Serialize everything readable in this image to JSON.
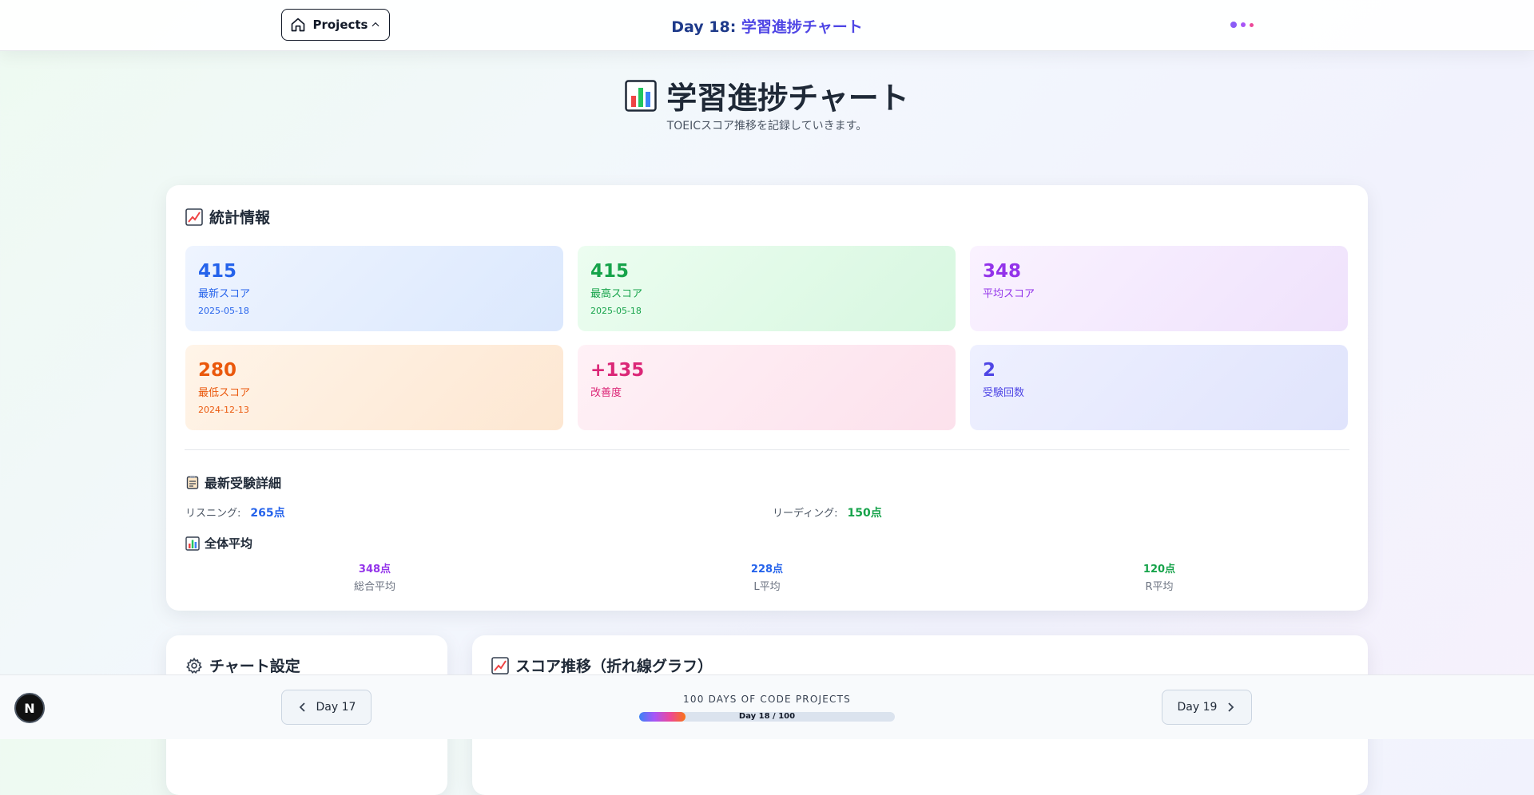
{
  "header": {
    "projects_label": "Projects",
    "day_prefix": "Day 18:",
    "day_title": "学習進捗チャート",
    "dot_colors": [
      "#8b5cf6",
      "#a855f7",
      "#ec4899"
    ]
  },
  "hero": {
    "icon": "bar-chart-icon",
    "title": "学習進捗チャート",
    "subtitle": "TOEICスコア推移を記録していきます。"
  },
  "stats": {
    "title": "統計情報",
    "icon": "trend-chart-icon",
    "tiles": [
      {
        "value": "415",
        "label": "最新スコア",
        "date": "2025-05-18",
        "color": "#2563eb"
      },
      {
        "value": "415",
        "label": "最高スコア",
        "date": "2025-05-18",
        "color": "#16a34a"
      },
      {
        "value": "348",
        "label": "平均スコア",
        "date": "",
        "color": "#9333ea"
      },
      {
        "value": "280",
        "label": "最低スコア",
        "date": "2024-12-13",
        "color": "#ea580c"
      },
      {
        "value": "+135",
        "label": "改善度",
        "date": "",
        "color": "#db2777"
      },
      {
        "value": "2",
        "label": "受験回数",
        "date": "",
        "color": "#4f46e5"
      }
    ],
    "latest": {
      "title": "最新受験詳細",
      "listening_label": "リスニング:",
      "listening_value": "265点",
      "reading_label": "リーディング:",
      "reading_value": "150点"
    },
    "averages": {
      "title": "全体平均",
      "items": [
        {
          "value": "348点",
          "label": "総合平均",
          "color": "#9333ea"
        },
        {
          "value": "228点",
          "label": "L平均",
          "color": "#2563eb"
        },
        {
          "value": "120点",
          "label": "R平均",
          "color": "#16a34a"
        }
      ]
    }
  },
  "settings": {
    "title": "チャート設定",
    "icon": "gear-icon"
  },
  "chart_panel": {
    "title": "スコア推移（折れ線グラフ）",
    "icon": "trend-chart-icon"
  },
  "footer": {
    "prev_label": "Day 17",
    "next_label": "Day 19",
    "series_label": "100 DAYS OF CODE PROJECTS",
    "progress_text": "Day 18 / 100",
    "progress_fraction": 0.18
  },
  "badge": {
    "letter": "N"
  }
}
